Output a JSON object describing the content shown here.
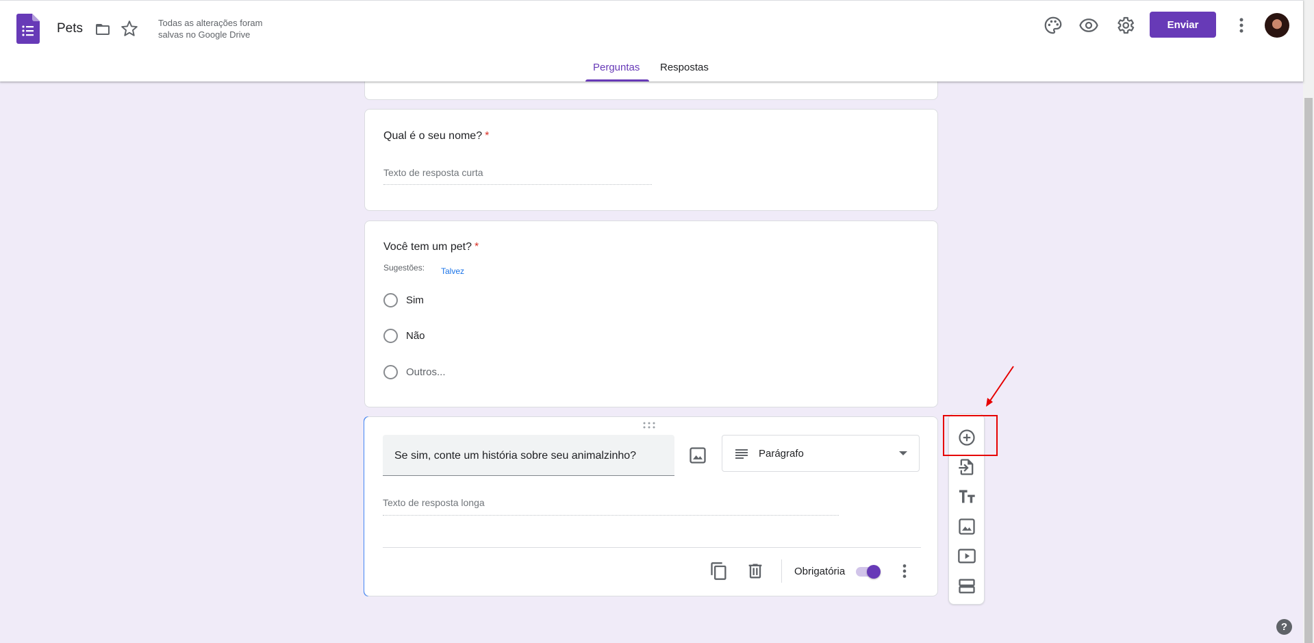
{
  "header": {
    "title": "Pets",
    "save_status": "Todas as alterações foram salvas no Google Drive",
    "send_label": "Enviar",
    "tabs": [
      {
        "label": "Perguntas",
        "active": true
      },
      {
        "label": "Respostas",
        "active": false
      }
    ]
  },
  "questions": [
    {
      "title": "Qual é o seu nome?",
      "required_mark": "*",
      "answer_placeholder": "Texto de resposta curta"
    },
    {
      "title": "Você tem um pet?",
      "required_mark": "*",
      "suggestions_label": "Sugestões:",
      "suggestion": "Talvez",
      "options": [
        "Sim",
        "Não",
        "Outros..."
      ]
    },
    {
      "title": "Se sim, conte um história sobre seu animalzinho?",
      "type": "Parágrafo",
      "answer_placeholder": "Texto de resposta longa",
      "required_label": "Obrigatória",
      "required_on": true
    }
  ],
  "help_label": "?",
  "colors": {
    "accent": "#673ab7",
    "active_question": "#4285f4",
    "required": "#d93025",
    "annotation": "#e60000",
    "background": "#f0ebf8"
  },
  "icons": {
    "logo": "google-forms-logo",
    "folder": "folder-icon",
    "star": "star-icon",
    "palette": "palette-icon",
    "preview": "eye-icon",
    "settings": "gear-icon",
    "more": "more-vert-icon",
    "toolbar": [
      "add-circle-icon",
      "import-icon",
      "title-icon",
      "image-icon",
      "video-icon",
      "section-icon"
    ]
  }
}
